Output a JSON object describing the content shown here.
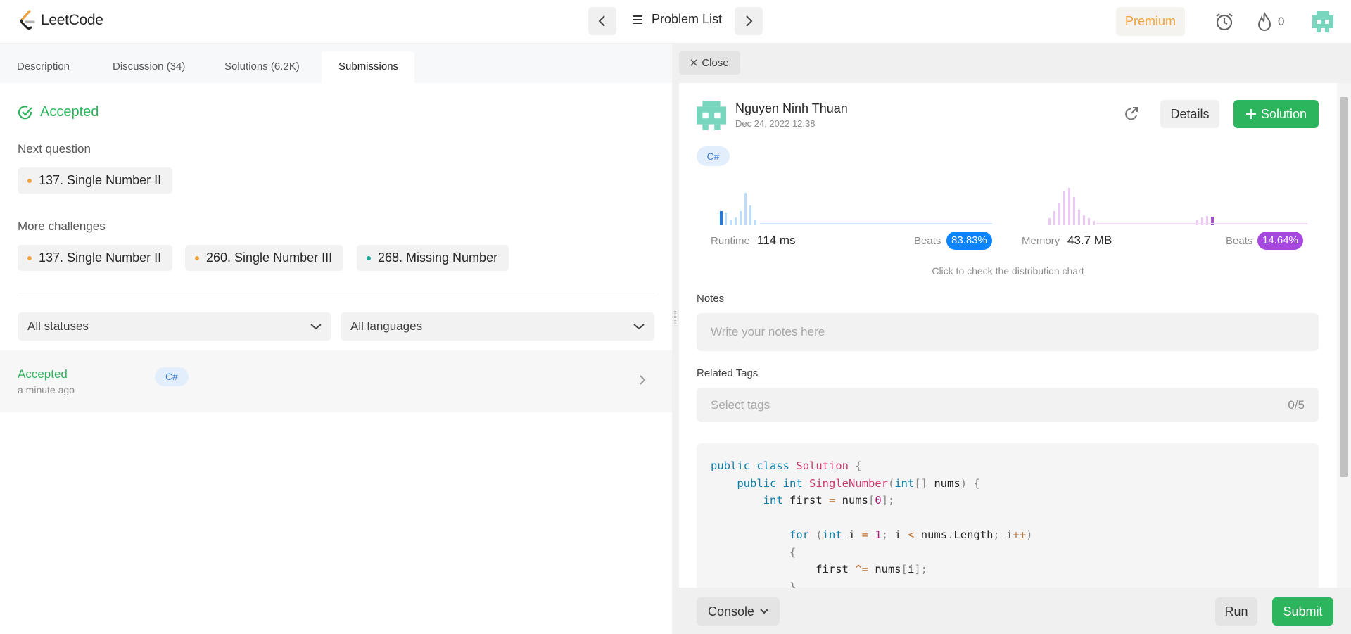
{
  "app": {
    "logo_text": "LeetCode"
  },
  "topnav": {
    "problem_list_label": "Problem List",
    "premium_label": "Premium",
    "streak_count": "0"
  },
  "tabs": [
    {
      "label": "Description"
    },
    {
      "label": "Discussion (34)"
    },
    {
      "label": "Solutions (6.2K)"
    },
    {
      "label": "Submissions",
      "active": true
    }
  ],
  "left": {
    "status_heading": "Accepted",
    "next_question_label": "Next question",
    "next_question": {
      "title": "137. Single Number II",
      "difficulty_color": "#f0a33e"
    },
    "more_challenges_label": "More challenges",
    "more_challenges": [
      {
        "title": "137. Single Number II",
        "difficulty_color": "#f0a33e"
      },
      {
        "title": "260. Single Number III",
        "difficulty_color": "#f0a33e"
      },
      {
        "title": "268. Missing Number",
        "difficulty_color": "#1aa596"
      }
    ],
    "filters": {
      "status_value": "All statuses",
      "language_value": "All languages"
    },
    "submissions": [
      {
        "status": "Accepted",
        "time": "a minute ago",
        "language": "C#"
      }
    ]
  },
  "right": {
    "close_label": "Close",
    "user_name": "Nguyen Ninh Thuan",
    "date": "Dec 24, 2022 12:38",
    "details_label": "Details",
    "solution_label": "Solution",
    "language": "C#",
    "runtime": {
      "label": "Runtime",
      "value": "114 ms",
      "beats_label": "Beats",
      "beats_value": "83.83%",
      "color": "#0a84ff"
    },
    "memory": {
      "label": "Memory",
      "value": "43.7 MB",
      "beats_label": "Beats",
      "beats_value": "14.64%",
      "color": "#a648e0"
    },
    "distribution_hint": "Click to check the distribution chart",
    "notes_label": "Notes",
    "notes_placeholder": "Write your notes here",
    "tags_label": "Related Tags",
    "tags_placeholder": "Select tags",
    "tags_count": "0/5"
  },
  "bottom": {
    "console_label": "Console",
    "run_label": "Run",
    "submit_label": "Submit"
  },
  "colors": {
    "accent_green": "#2db55d",
    "premium_orange": "#f0a33e"
  }
}
